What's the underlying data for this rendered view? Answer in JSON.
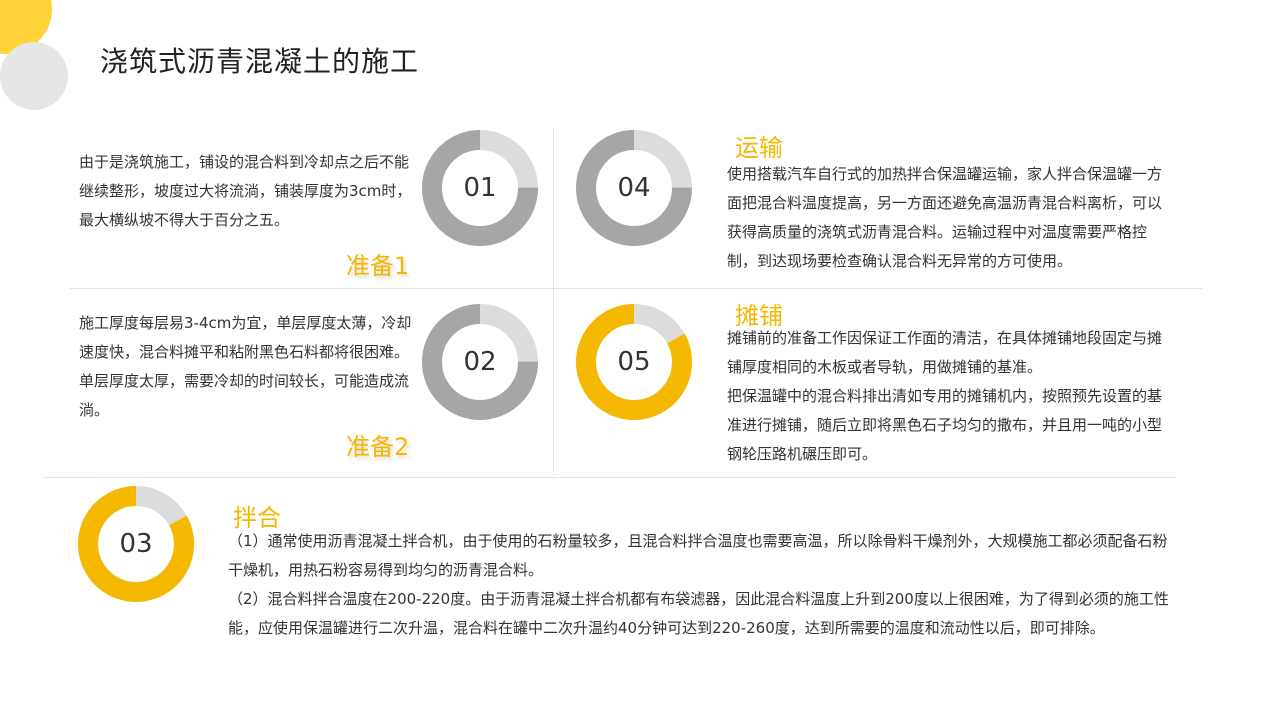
{
  "page": {
    "title": "浇筑式沥青混凝土的施工"
  },
  "colors": {
    "accent": "#f5b800",
    "gray_ring": "#a6a6a6",
    "track": "#dcdcdc"
  },
  "sections": [
    {
      "number": "01",
      "heading": "准备1",
      "ring_color": "gray_ring",
      "ring_fill": 0.75,
      "paragraphs": [
        "由于是浇筑施工，铺设的混合料到冷却点之后不能继续整形，坡度过大将流淌，铺装厚度为3cm时，最大横纵坡不得大于百分之五。"
      ]
    },
    {
      "number": "02",
      "heading": "准备2",
      "ring_color": "gray_ring",
      "ring_fill": 0.75,
      "paragraphs": [
        "施工厚度每层易3-4cm为宜，单层厚度太薄，冷却速度快，混合料摊平和粘附黑色石料都将很困难。单层厚度太厚，需要冷却的时间较长，可能造成流淌。"
      ]
    },
    {
      "number": "03",
      "heading": "拌合",
      "ring_color": "accent",
      "ring_fill": 0.83,
      "paragraphs": [
        "（1）通常使用沥青混凝土拌合机，由于使用的石粉量较多，且混合料拌合温度也需要高温，所以除骨料干燥剂外，大规模施工都必须配备石粉干燥机，用热石粉容易得到均匀的沥青混合料。",
        "（2）混合料拌合温度在200-220度。由于沥青混凝土拌合机都有布袋滤器，因此混合料温度上升到200度以上很困难，为了得到必须的施工性能，应使用保温罐进行二次升温，混合料在罐中二次升温约40分钟可达到220-260度，达到所需要的温度和流动性以后，即可排除。"
      ]
    },
    {
      "number": "04",
      "heading": "运输",
      "ring_color": "gray_ring",
      "ring_fill": 0.75,
      "paragraphs": [
        "使用搭载汽车自行式的加热拌合保温罐运输，家人拌合保温罐一方面把混合料温度提高，另一方面还避免高温沥青混合料离析，可以获得高质量的浇筑式沥青混合料。运输过程中对温度需要严格控制，到达现场要检查确认混合料无异常的方可使用。"
      ]
    },
    {
      "number": "05",
      "heading": "摊铺",
      "ring_color": "accent",
      "ring_fill": 0.83,
      "paragraphs": [
        "摊铺前的准备工作因保证工作面的清洁，在具体摊铺地段固定与摊铺厚度相同的木板或者导轨，用做摊铺的基准。",
        "把保温罐中的混合料排出清如专用的摊铺机内，按照预先设置的基准进行摊铺，随后立即将黑色石子均匀的撒布，并且用一吨的小型钢轮压路机碾压即可。"
      ]
    }
  ]
}
